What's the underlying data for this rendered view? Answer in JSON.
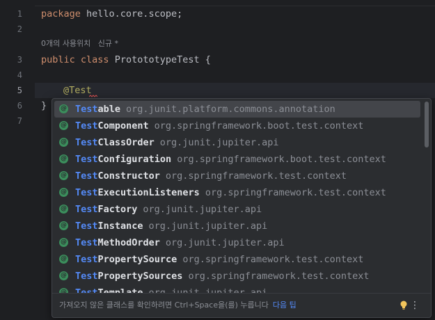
{
  "editor": {
    "line_numbers": [
      "1",
      "2",
      "3",
      "4",
      "5",
      "6",
      "7"
    ],
    "lines": {
      "l1_kw": "package",
      "l1_rest": " hello.core.scope;",
      "l3_kw1": "public",
      "l3_kw2": "class",
      "l3_cls": "ProtototypeTest",
      "l3_brace": " {",
      "l5_annot": "@Test",
      "l6": "}"
    },
    "inlay_hint": "0개의 사용위치   신규 *"
  },
  "completion": {
    "icon_letter": "@",
    "items": [
      {
        "match": "Test",
        "rest": "able",
        "pkg": "org.junit.platform.commons.annotation"
      },
      {
        "match": "Test",
        "rest": "Component",
        "pkg": "org.springframework.boot.test.context"
      },
      {
        "match": "Test",
        "rest": "ClassOrder",
        "pkg": "org.junit.jupiter.api"
      },
      {
        "match": "Test",
        "rest": "Configuration",
        "pkg": "org.springframework.boot.test.context"
      },
      {
        "match": "Test",
        "rest": "Constructor",
        "pkg": "org.springframework.test.context"
      },
      {
        "match": "Test",
        "rest": "ExecutionListeners",
        "pkg": "org.springframework.test.context"
      },
      {
        "match": "Test",
        "rest": "Factory",
        "pkg": "org.junit.jupiter.api"
      },
      {
        "match": "Test",
        "rest": "Instance",
        "pkg": "org.junit.jupiter.api"
      },
      {
        "match": "Test",
        "rest": "MethodOrder",
        "pkg": "org.junit.jupiter.api"
      },
      {
        "match": "Test",
        "rest": "PropertySource",
        "pkg": "org.springframework.test.context"
      },
      {
        "match": "Test",
        "rest": "PropertySources",
        "pkg": "org.springframework.test.context"
      },
      {
        "match": "Test",
        "rest": "Template",
        "pkg": "org.junit.jupiter.api"
      }
    ],
    "footer_text": "가져오지 않은 클래스를 확인하려면 Ctrl+Space을(를) 누릅니다",
    "footer_link": "다음 팁",
    "more_glyph": "⋮"
  },
  "colors": {
    "background": "#1e1f22",
    "keyword": "#cf8e6d",
    "annotation": "#b3ae60",
    "match": "#548af7",
    "icon": "#3b8e5c"
  }
}
